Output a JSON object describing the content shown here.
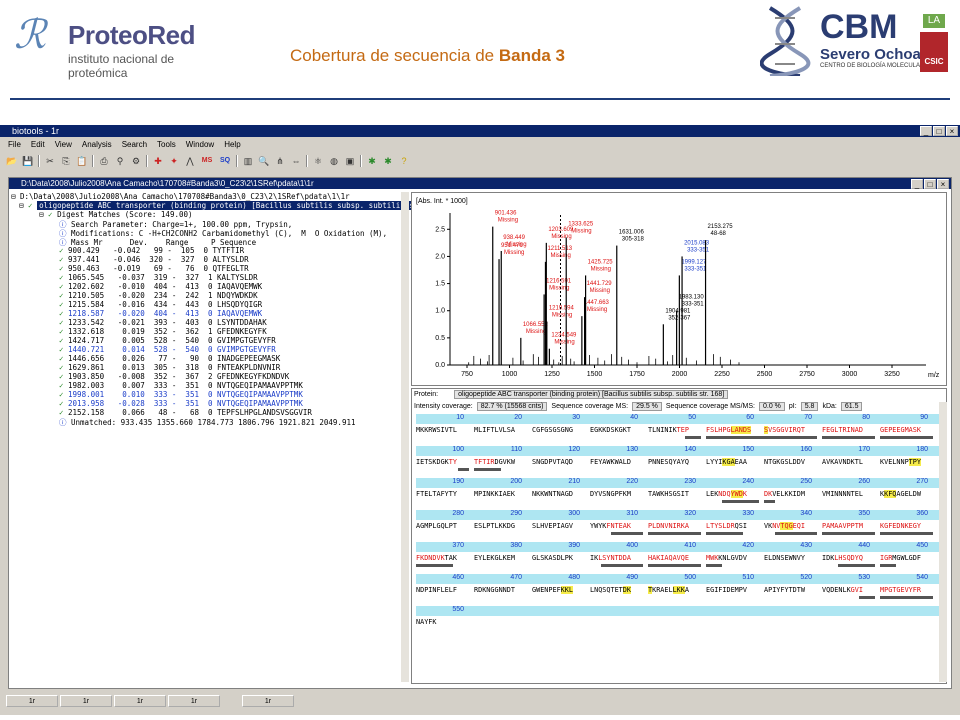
{
  "slide": {
    "logo_left_name": "ProteoRed",
    "logo_left_sub": "instituto nacional de proteómica",
    "title_prefix": "Cobertura de secuencia de ",
    "title_bold": "Banda 3",
    "logo_right_name": "CBM",
    "logo_right_sub": "Severo Ochoa",
    "logo_right_sub2": "CENTRO DE BIOLOGÍA MOLECULAR",
    "logo_right_badge_top": "LA",
    "logo_right_badge": "CSIC"
  },
  "app": {
    "title": "biotools - 1r",
    "menu": [
      "File",
      "Edit",
      "View",
      "Analysis",
      "Search",
      "Tools",
      "Window",
      "Help"
    ],
    "toolbar_icons": [
      "open-icon",
      "save-icon",
      "cut-icon",
      "copy-icon",
      "paste-icon",
      "print-icon",
      "filter-icon",
      "tool-icon",
      "crosshair-icon",
      "marker-icon",
      "peaks-icon",
      "ms-icon",
      "sq-icon",
      "chart-icon",
      "zoom-icon",
      "tree-icon",
      "fit-icon",
      "globe-icon",
      "compute-icon",
      "export-icon",
      "import-icon",
      "help-icon"
    ],
    "toolbar_text": {
      "ms": "MS",
      "sq": "SQ"
    },
    "child_title": "D:\\Data\\2008\\Julio2008\\Ana Camacho\\170708#Banda3\\0_C23\\2\\1SRef\\pdata\\1\\1r",
    "tasks": [
      "1r",
      "1r",
      "1r",
      "1r",
      "1r"
    ]
  },
  "tree": {
    "root": "D:\\Data\\2008\\Julio2008\\Ana Camacho\\170708#Banda3\\0_C23\\2\\1SRef\\pdata\\1\\1r",
    "protein": "oligopeptide ABC transporter (binding protein) [Bacillus subtilis subsp. subtilis str. 168]",
    "digest": "Digest Matches (Score: 149.00)",
    "search_param": "Search Parameter: Charge=1+, 100.00 ppm, Trypsin,",
    "modifications": "Modifications: C -H+CH2CONH2 Carbamidomethyl (C),  M  O Oxidation (M),",
    "header": "Mass Mr      Dev.    Range     P Sequence",
    "rows": [
      {
        "text": "900.429   -0.042   99 -  105  0 TYTFTIR",
        "blue": false
      },
      {
        "text": "937.441   -0.046  320 -  327  0 ALTYSLDR",
        "blue": false
      },
      {
        "text": "950.463   -0.019   69 -   76  0 QTFEGLTR",
        "blue": false
      },
      {
        "text": "1065.545   -0.037  319 -  327  1 KALTYSLDR",
        "blue": false
      },
      {
        "text": "1202.602   -0.010  404 -  413  0 IAQAVQEMWK",
        "blue": false
      },
      {
        "text": "1210.505   -0.020  234 -  242  1 NDQYWDKDK",
        "blue": false
      },
      {
        "text": "1215.584   -0.016  434 -  443  0 LHSQDYQIGR",
        "blue": false
      },
      {
        "text": "1218.587   -0.020  404 -  413  0 IAQAVQEMWK",
        "blue": true
      },
      {
        "text": "1233.542   -0.021  393 -  403  0 LSYNTDDAHAK",
        "blue": false
      },
      {
        "text": "1332.618    0.019  352 -  362  1 GFEDNKEGYFK",
        "blue": false
      },
      {
        "text": "1424.717    0.005  528 -  540  0 GVIMPGTGEVYFR",
        "blue": false
      },
      {
        "text": "1440.721    0.014  528 -  540  0 GVIMPGTGEVYFR",
        "blue": true
      },
      {
        "text": "1446.656    0.026   77 -   90  0 INADGEPEEGMASK",
        "blue": false
      },
      {
        "text": "1629.861    0.013  305 -  318  0 FNTEAKPLDNVNIR",
        "blue": false
      },
      {
        "text": "1903.850   -0.008  352 -  367  2 GFEDNKEGYFKDNDVK",
        "blue": false
      },
      {
        "text": "1982.003    0.007  333 -  351  0 NVTQGEQIPAMAAVPPTMK",
        "blue": false
      },
      {
        "text": "1998.001    0.010  333 -  351  0 NVTQGEQIPAMAAVPPTMK",
        "blue": true
      },
      {
        "text": "2013.958   -0.028  333 -  351  0 NVTQGEQIPAMAAVPPTMK",
        "blue": true
      },
      {
        "text": "2152.158    0.066   48 -   68  0 TEPFSLHPGLANDSVSGGVIR",
        "blue": false
      }
    ],
    "unmatched": "Unmatched: 933.435 1355.660 1784.773 1806.796 1921.821 2049.911"
  },
  "spectrum": {
    "ylabel": "[Abs. Int. * 1000]",
    "xunit": "m/z",
    "yticks": [
      "2.5",
      "2.0",
      "1.5",
      "1.0",
      "0.5",
      "0.0"
    ],
    "xticks": [
      "750",
      "1000",
      "1250",
      "1500",
      "1750",
      "2000",
      "2250",
      "2500",
      "2750",
      "3000",
      "3250"
    ],
    "annotations": [
      {
        "text": "901.436",
        "sub": "Missing",
        "color": "#d11"
      },
      {
        "text": "951.471",
        "sub": "Missing",
        "color": "#d11"
      },
      {
        "text": "938.449",
        "sub": "Missing",
        "color": "#d11"
      },
      {
        "text": "1066.552",
        "sub": "Missing",
        "color": "#d11"
      },
      {
        "text": "1216.591",
        "sub": "Missing",
        "color": "#d11"
      },
      {
        "text": "1211.513",
        "sub": "Missing",
        "color": "#d11"
      },
      {
        "text": "1203.609",
        "sub": "Missing",
        "color": "#d11"
      },
      {
        "text": "1219.594",
        "sub": "Missing",
        "color": "#d11"
      },
      {
        "text": "1234.549",
        "sub": "Missing",
        "color": "#d11"
      },
      {
        "text": "1333.625",
        "sub": "Missing",
        "color": "#d11"
      },
      {
        "text": "1447.663",
        "sub": "Missing",
        "color": "#d11"
      },
      {
        "text": "1441.729",
        "sub": "Missing",
        "color": "#d11"
      },
      {
        "text": "1425.725",
        "sub": "Missing",
        "color": "#d11"
      },
      {
        "text": "1631.006",
        "sub": "305-318",
        "color": "#000"
      },
      {
        "text": "1904.981",
        "sub": "352-367",
        "color": "#000"
      },
      {
        "text": "1983.130",
        "sub": "333-351",
        "color": "#000"
      },
      {
        "text": "1999.127",
        "sub": "333-351",
        "color": "#1a3cc8"
      },
      {
        "text": "2015.083",
        "sub": "333-351",
        "color": "#1a3cc8"
      },
      {
        "text": "2153.275",
        "sub": "48-68",
        "color": "#000"
      }
    ]
  },
  "chart_data": {
    "type": "bar",
    "title": "",
    "xlabel": "m/z",
    "ylabel": "[Abs. Int. * 1000]",
    "xlim": [
      650,
      3450
    ],
    "ylim": [
      0,
      2.8
    ],
    "peaks": [
      {
        "x": 901.436,
        "y": 2.55
      },
      {
        "x": 938.449,
        "y": 1.95
      },
      {
        "x": 951.471,
        "y": 2.1
      },
      {
        "x": 1066.552,
        "y": 0.5
      },
      {
        "x": 1203.609,
        "y": 1.3
      },
      {
        "x": 1211.513,
        "y": 1.9
      },
      {
        "x": 1216.591,
        "y": 2.25
      },
      {
        "x": 1219.594,
        "y": 0.8
      },
      {
        "x": 1234.549,
        "y": 0.3
      },
      {
        "x": 1333.625,
        "y": 2.35
      },
      {
        "x": 1425.725,
        "y": 0.9
      },
      {
        "x": 1441.729,
        "y": 1.25
      },
      {
        "x": 1447.663,
        "y": 1.65
      },
      {
        "x": 1631.006,
        "y": 2.2
      },
      {
        "x": 1904.981,
        "y": 0.75
      },
      {
        "x": 1983.13,
        "y": 1.0
      },
      {
        "x": 1999.127,
        "y": 1.65
      },
      {
        "x": 2015.083,
        "y": 2.0
      },
      {
        "x": 2153.275,
        "y": 2.3
      }
    ]
  },
  "coverage": {
    "protein_label": "Protein:",
    "protein_value": "oligopeptide ABC transporter (binding protein) [Bacillus subtilis subsp. subtilis str. 168]",
    "intensity_label": "Intensity coverage:",
    "intensity_value": "82.7 % (15568 cnts)",
    "ms_label": "Sequence coverage MS:",
    "ms_value": "29.5 %",
    "msms_label": "Sequence coverage MS/MS:",
    "msms_value": "0.0 %",
    "pi_label": "pI:",
    "pi_value": "5.8",
    "kda_label": "kDa:",
    "kda_value": "61.5",
    "blocks": [
      {
        "ruler": [
          "10",
          "20",
          "30",
          "40",
          "50",
          "60",
          "70",
          "80",
          "90"
        ],
        "seq": [
          "MKKRWSIVTL",
          "MLIFTLVLSA",
          "CGFGSGSGNG",
          "EGKKDSKGKT",
          "TLNINIKTEP",
          "FSLHPGLANDS",
          "SVSGGVIRQT",
          "FEGLTRINAD",
          "GEPEEGMASK"
        ]
      },
      {
        "ruler": [
          "100",
          "110",
          "120",
          "130",
          "140",
          "150",
          "160",
          "170",
          "180"
        ],
        "seq": [
          "IETSKDGKTY",
          "TFTIRDGVKW",
          "SNGDPVTAQD",
          "FEYAWKWALD",
          "PNNESQYAYQ",
          "LYYIKGAEAA",
          "NTGKGSLDDV",
          "AVKAVNDKTL",
          "KVELNNPTPY"
        ]
      },
      {
        "ruler": [
          "190",
          "200",
          "210",
          "220",
          "230",
          "240",
          "250",
          "260",
          "270"
        ],
        "seq": [
          "FTELTAFYTY",
          "MPINKKIAEK",
          "NKKWNTNAGD",
          "DYVSNGPFKM",
          "TAWKHSGSIT",
          "LEKNDQYWDK",
          "DKVELKKIDM",
          "VMINNNNTEL",
          "KKFQAGELDW"
        ]
      },
      {
        "ruler": [
          "280",
          "290",
          "300",
          "310",
          "320",
          "330",
          "340",
          "350",
          "360"
        ],
        "seq": [
          "AGMPLGQLPT",
          "ESLPTLKKDG",
          "SLHVEPIAGV",
          "YWYKFNTEAK",
          "PLDNVNIRKA",
          "LTYSLDRQSI",
          "VKNVTQGEQI",
          "PAMAAVPPTM",
          "KGFEDNKEGY"
        ]
      },
      {
        "ruler": [
          "370",
          "380",
          "390",
          "400",
          "410",
          "420",
          "430",
          "440",
          "450"
        ],
        "seq": [
          "FKDNDVKTAK",
          "EYLEKGLKEM",
          "GLSKASDLPK",
          "IKLSYNTDDA",
          "HAKIAQAVQE",
          "MWKKNLGVDV",
          "ELDNSEWNVY",
          "IDKLHSQDYQ",
          "IGRMGWLGDF"
        ]
      },
      {
        "ruler": [
          "460",
          "470",
          "480",
          "490",
          "500",
          "510",
          "520",
          "530",
          "540"
        ],
        "seq": [
          "NDPINFLELF",
          "RDKNGGNNDT",
          "GWENPEFKKL",
          "LNQSQTETDK",
          "TKRAELLKKA",
          "EGIFIDEMPV",
          "APIYFYTDTW",
          "VQDENLKGVI",
          "MPGTGEVYFR"
        ]
      },
      {
        "ruler": [
          "550"
        ],
        "seq": [
          "NAYFK"
        ]
      }
    ]
  }
}
